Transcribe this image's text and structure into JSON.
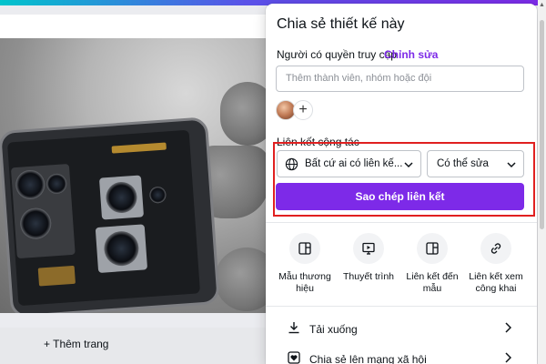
{
  "editor": {
    "add_page_label": "+ Thêm trang"
  },
  "share_panel": {
    "title": "Chia sẻ thiết kế này",
    "access_label": "Người có quyền truy cập",
    "edit_link": "Chỉnh sửa",
    "member_input_placeholder": "Thêm thành viên, nhóm hoặc đội",
    "collab_link_label": "Liên kết cộng tác",
    "link_access_value": "Bất cứ ai có liên kế...",
    "permission_value": "Có thể sửa",
    "copy_link_label": "Sao chép liên kết",
    "options": [
      {
        "label": "Mẫu thương hiệu",
        "icon": "template-icon"
      },
      {
        "label": "Thuyết trình",
        "icon": "present-icon"
      },
      {
        "label": "Liên kết đến mẫu",
        "icon": "template-link-icon"
      },
      {
        "label": "Liên kết xem công khai",
        "icon": "link-icon"
      }
    ],
    "rows": [
      {
        "label": "Tải xuống",
        "icon": "download-icon"
      },
      {
        "label": "Chia sẻ lên mạng xã hội",
        "icon": "heart-icon"
      }
    ]
  },
  "colors": {
    "accent": "#7d2ae8",
    "highlight": "#e02020"
  }
}
